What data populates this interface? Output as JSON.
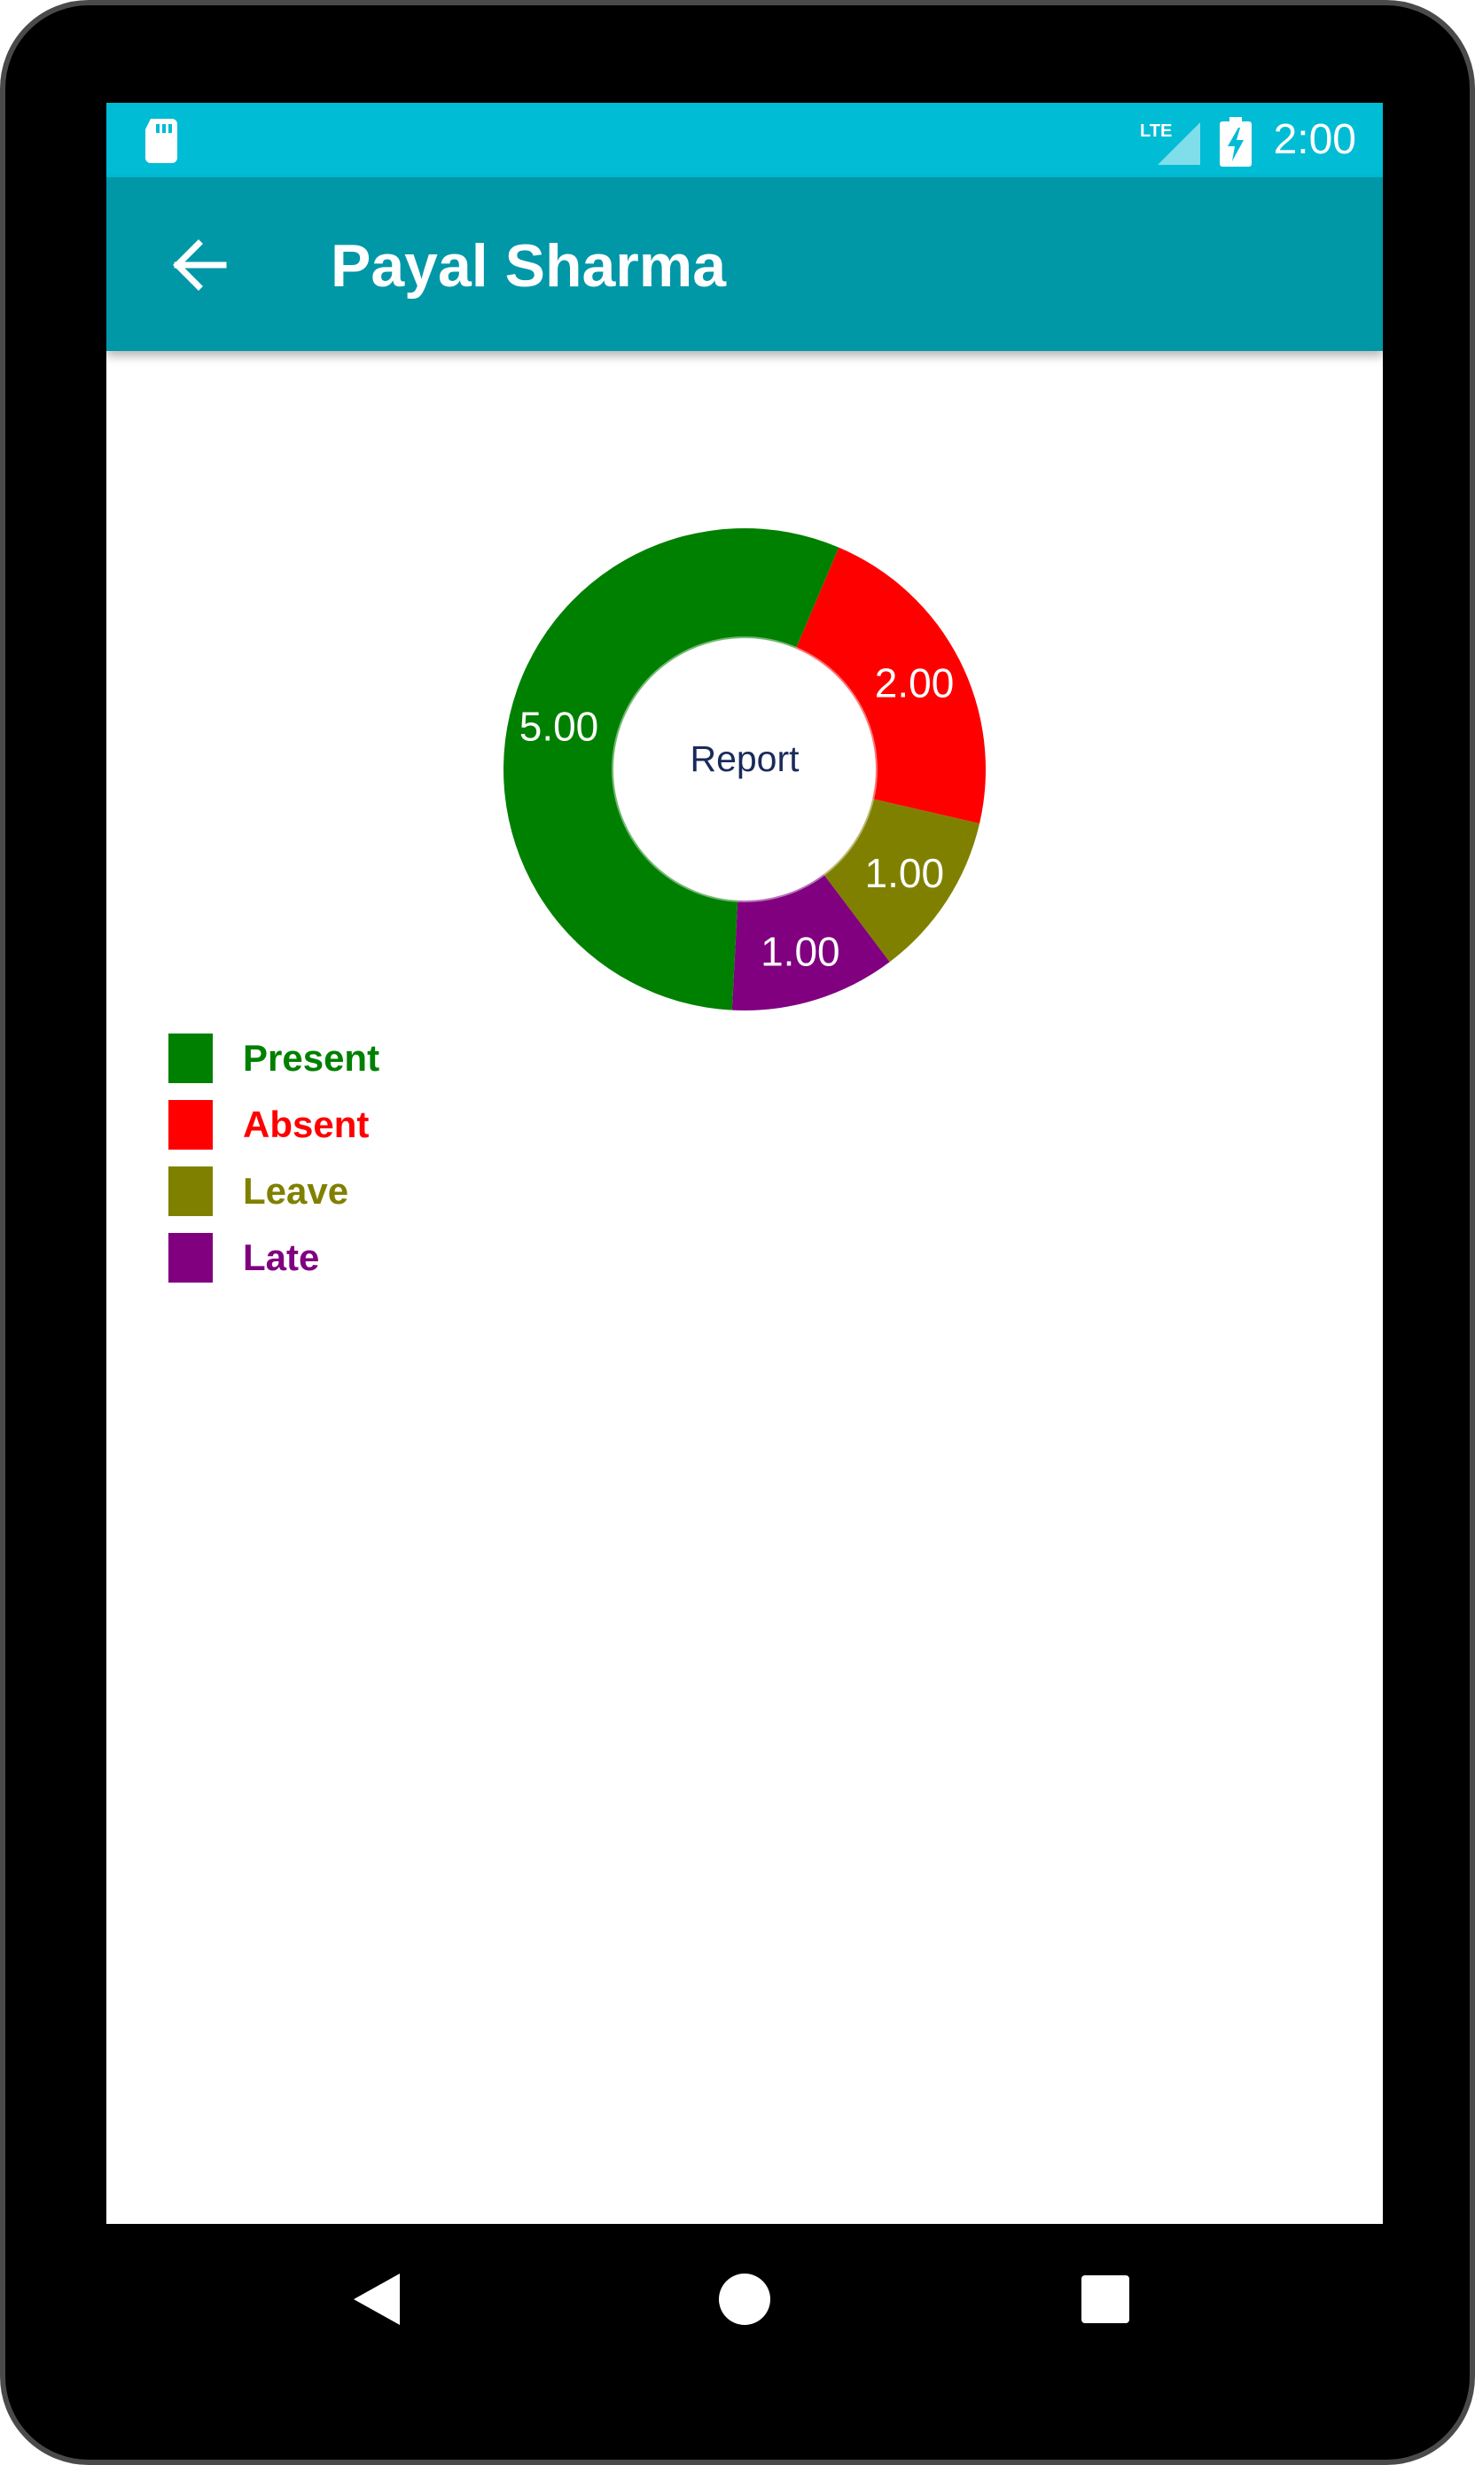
{
  "status_bar": {
    "time": "2:00",
    "network_label": "LTE",
    "icons": [
      "sd-card-icon",
      "lte-signal-icon",
      "battery-charging-icon"
    ],
    "background_color": "#00BCD4"
  },
  "app_bar": {
    "title": "Payal Sharma",
    "back_icon": "arrow-back-icon",
    "background_color": "#0097A7"
  },
  "chart_data": {
    "type": "pie",
    "variant": "donut",
    "center_text": "Report",
    "categories": [
      "Present",
      "Absent",
      "Leave",
      "Late"
    ],
    "values": [
      5,
      2,
      1,
      1
    ],
    "value_labels": [
      "5.00",
      "2.00",
      "1.00",
      "1.00"
    ],
    "colors": [
      "#008000",
      "#FF0000",
      "#808000",
      "#800080"
    ],
    "legend_position": "bottom-left"
  },
  "legend": [
    {
      "label": "Present",
      "color": "#008000"
    },
    {
      "label": "Absent",
      "color": "#FF0000"
    },
    {
      "label": "Leave",
      "color": "#808000"
    },
    {
      "label": "Late",
      "color": "#800080"
    }
  ],
  "nav_bar": {
    "buttons": [
      "back-triangle-icon",
      "home-circle-icon",
      "recents-square-icon"
    ]
  }
}
